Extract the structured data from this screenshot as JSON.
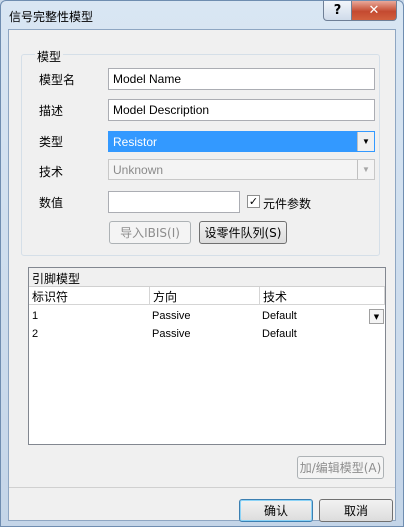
{
  "window": {
    "title": "信号完整性模型",
    "help": "?",
    "close": "✕"
  },
  "model": {
    "group_label": "模型",
    "name_label": "模型名",
    "name_value": "Model Name",
    "desc_label": "描述",
    "desc_value": "Model Description",
    "type_label": "类型",
    "type_value": "Resistor",
    "tech_label": "技术",
    "tech_value": "Unknown",
    "value_label": "数值",
    "value_value": "",
    "component_param_label": "元件参数",
    "component_param_checked": true,
    "import_ibis_label": "导入IBIS(I)",
    "setup_part_array_label": "设零件队列(S)"
  },
  "pins": {
    "title": "引脚模型",
    "columns": [
      "标识符",
      "方向",
      "技术"
    ],
    "rows": [
      [
        "1",
        "Passive",
        "Default"
      ],
      [
        "2",
        "Passive",
        "Default"
      ]
    ],
    "add_edit_label": "加/编辑模型(A)"
  },
  "footer": {
    "ok_label": "确认",
    "cancel_label": "取消"
  }
}
